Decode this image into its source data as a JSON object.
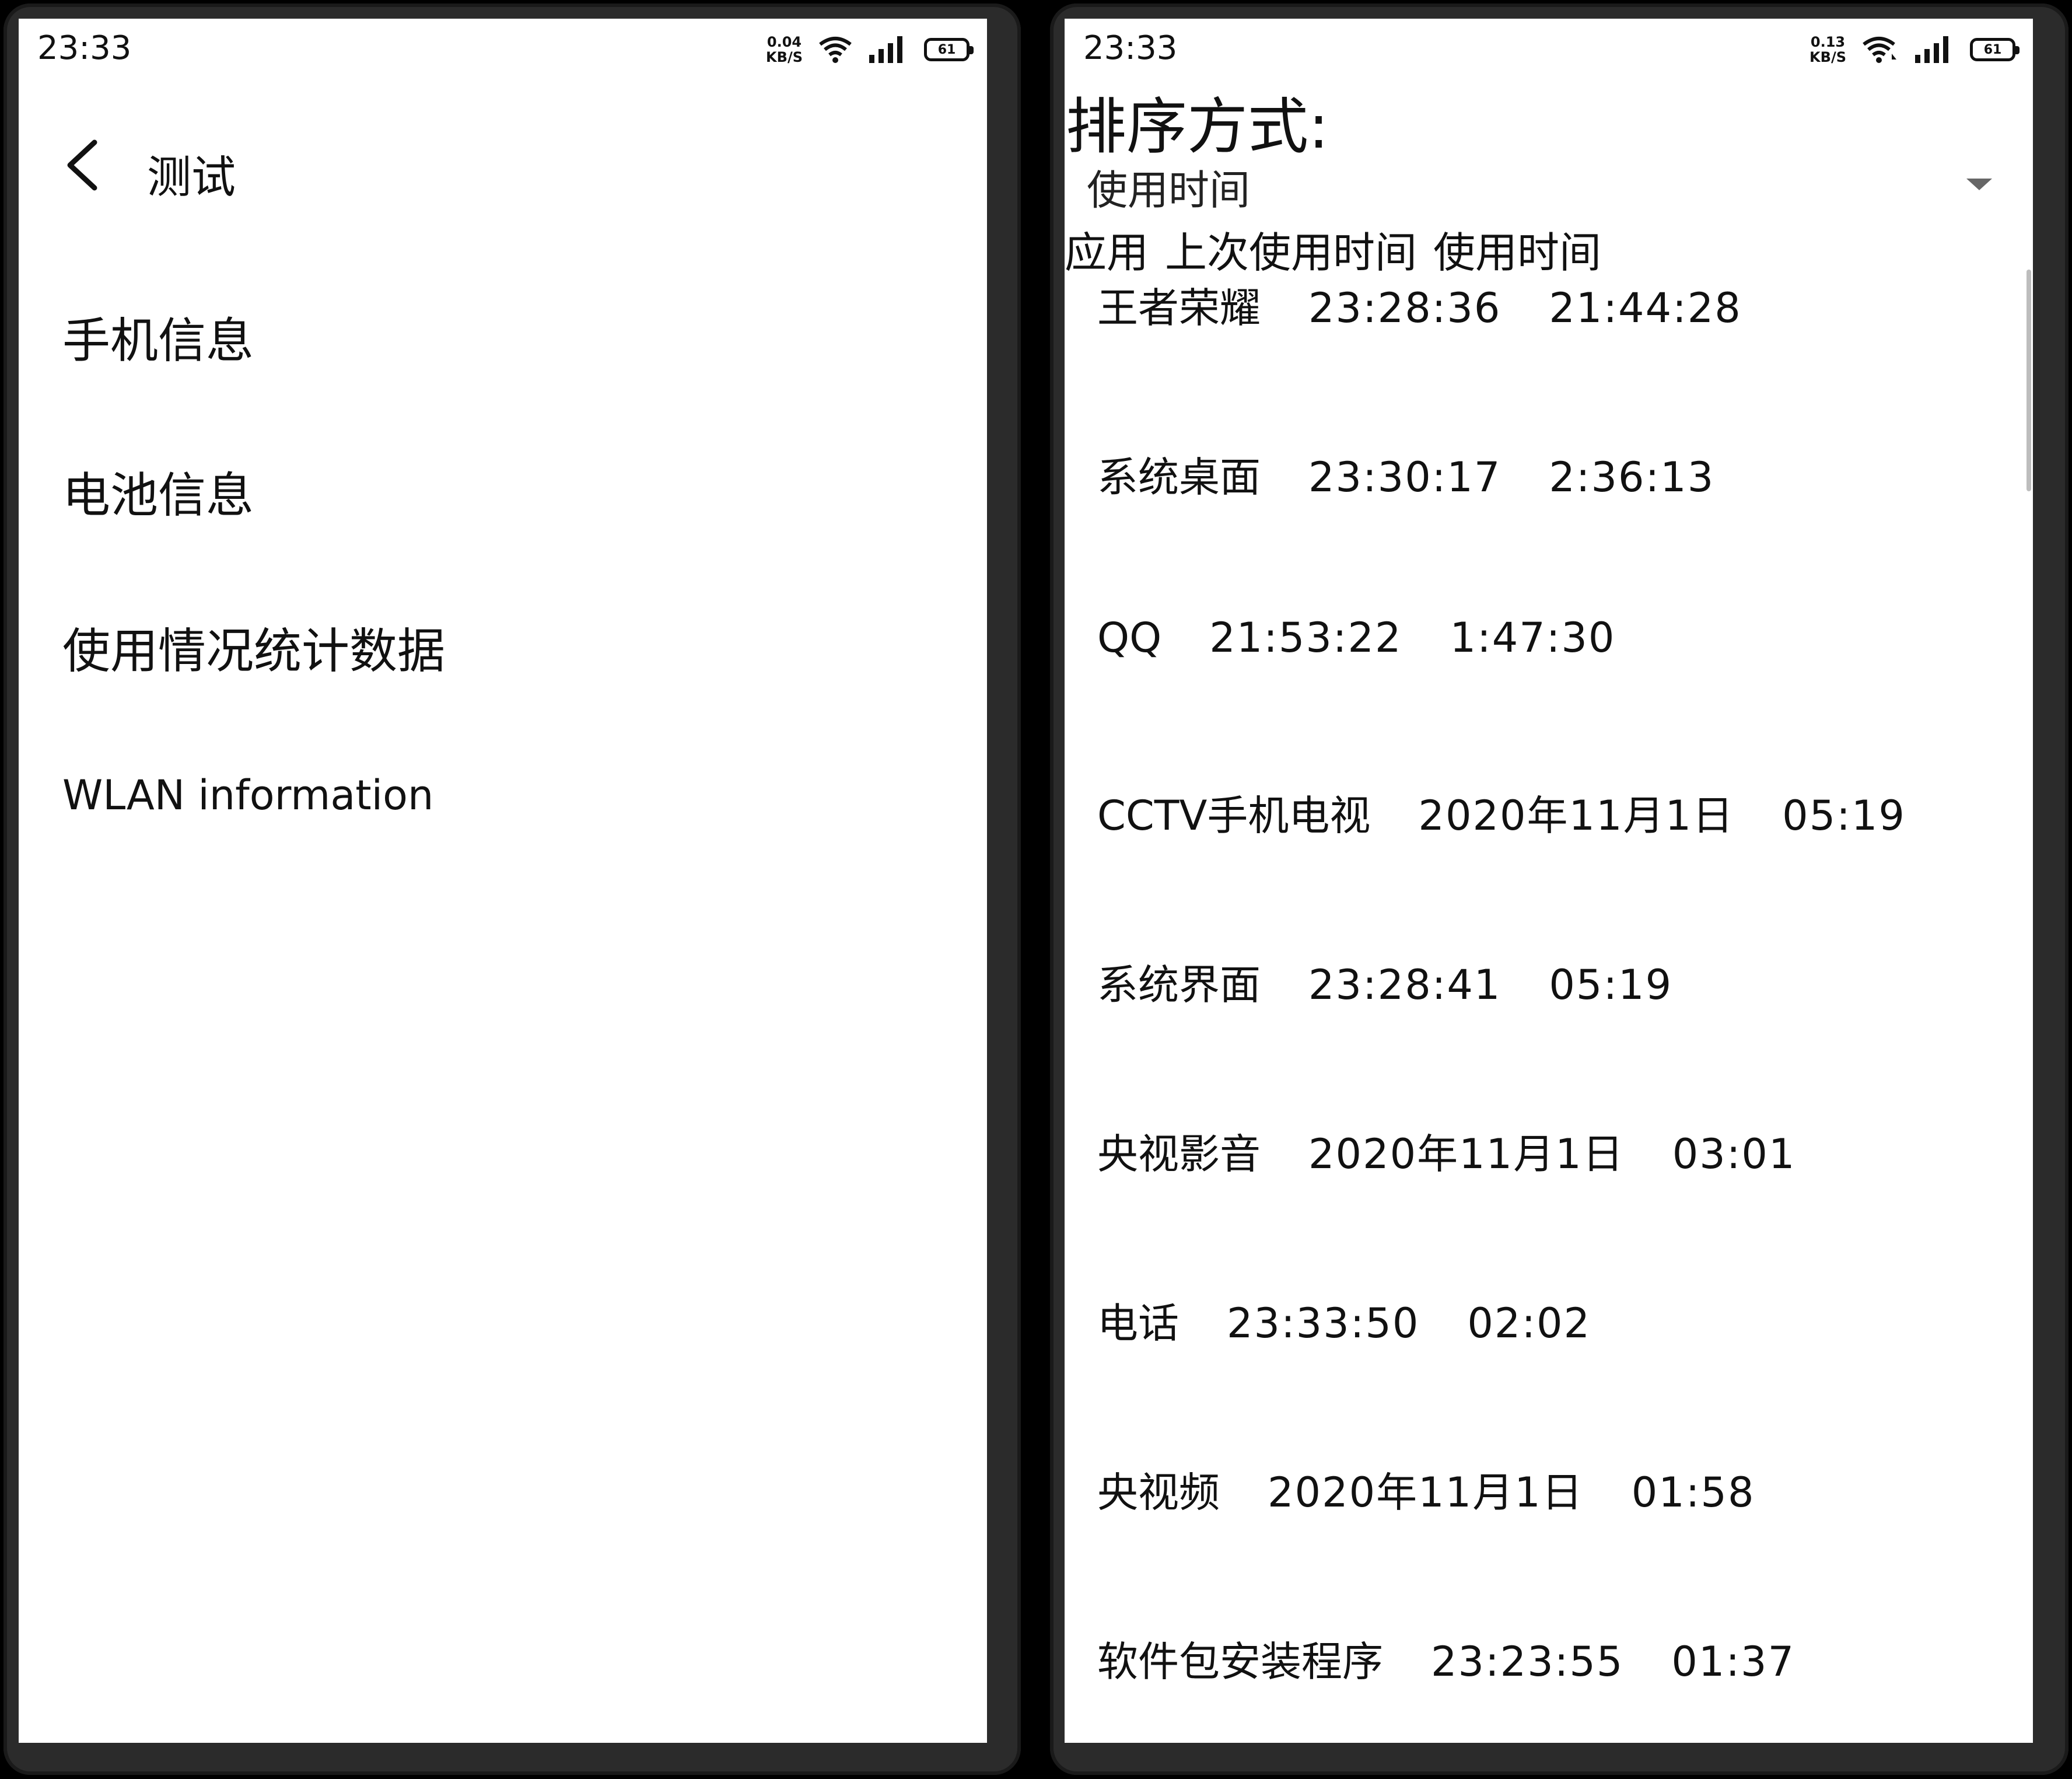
{
  "left": {
    "status": {
      "time": "23:33",
      "speed_value": "0.04",
      "speed_unit": "KB/S",
      "battery": "61"
    },
    "topbar": {
      "title": "测试"
    },
    "menu": [
      {
        "label": "手机信息"
      },
      {
        "label": "电池信息"
      },
      {
        "label": "使用情况统计数据"
      },
      {
        "label": "WLAN information"
      }
    ]
  },
  "right": {
    "status": {
      "time": "23:33",
      "speed_value": "0.13",
      "speed_unit": "KB/S",
      "battery": "61"
    },
    "sort_label": "排序方式:",
    "dropdown": {
      "selected": "使用时间"
    },
    "headers": {
      "app": "应用",
      "last_used": "上次使用时间",
      "usage_time": "使用时间"
    },
    "rows": [
      {
        "app": "王者荣耀",
        "last_used": "23:28:36",
        "usage_time": "21:44:28"
      },
      {
        "app": "系统桌面",
        "last_used": "23:30:17",
        "usage_time": "2:36:13"
      },
      {
        "app": "QQ",
        "last_used": "21:53:22",
        "usage_time": "1:47:30"
      },
      {
        "app": "CCTV手机电视",
        "last_used": "2020年11月1日",
        "usage_time": "05:19"
      },
      {
        "app": "系统界面",
        "last_used": "23:28:41",
        "usage_time": "05:19"
      },
      {
        "app": "央视影音",
        "last_used": "2020年11月1日",
        "usage_time": "03:01"
      },
      {
        "app": "电话",
        "last_used": "23:33:50",
        "usage_time": "02:02"
      },
      {
        "app": "央视频",
        "last_used": "2020年11月1日",
        "usage_time": "01:58"
      },
      {
        "app": "软件包安装程序",
        "last_used": "23:23:55",
        "usage_time": "01:37"
      }
    ]
  }
}
